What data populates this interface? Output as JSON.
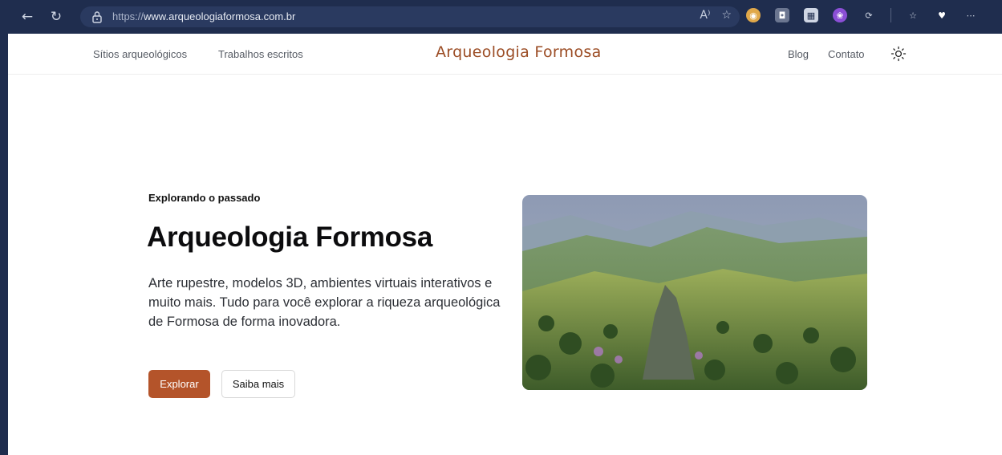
{
  "browser": {
    "url_scheme": "https://",
    "url_host": "www.arqueologiaformosa.com.br",
    "icons": [
      "back-icon",
      "refresh-icon",
      "lock-icon",
      "read-aloud-icon",
      "favorite-star-icon",
      "extension-icon",
      "camera-icon",
      "qr-icon",
      "brain-icon",
      "extensions-icon",
      "favorites-icon",
      "heart-icon",
      "more-icon"
    ]
  },
  "site_nav": {
    "left_links": [
      "Sítios arqueológicos",
      "Trabalhos escritos"
    ],
    "logo": "Arqueologia Formosa",
    "right_links": [
      "Blog",
      "Contato"
    ],
    "theme_icon": "sun-icon"
  },
  "hero": {
    "eyebrow": "Explorando o passado",
    "title": "Arqueologia Formosa",
    "description": "Arte rupestre, modelos 3D, ambientes virtuais interativos e muito mais. Tudo para você explorar a riqueza arqueológica de Formosa de forma inovadora.",
    "primary_button": "Explorar",
    "secondary_button": "Saiba mais",
    "image_icon": "landscape-photo"
  },
  "colors": {
    "accent": "#b4542a",
    "logo": "#9b4c24",
    "browser_chrome": "#1f2d4e"
  }
}
